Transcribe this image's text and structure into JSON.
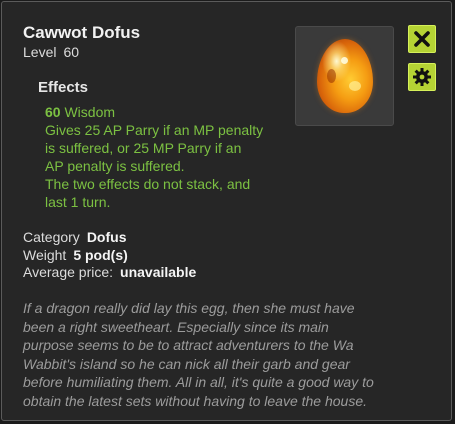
{
  "item": {
    "name": "Cawwot Dofus",
    "level_label": "Level",
    "level_value": "60"
  },
  "effects": {
    "title": "Effects",
    "wisdom_value": "60",
    "wisdom_label": "Wisdom",
    "lines": [
      "Gives 25 AP Parry if an MP penalty",
      "is suffered, or 25 MP Parry if an",
      "AP penalty is suffered.",
      "The two effects do not stack, and",
      "last 1 turn."
    ]
  },
  "info": {
    "category_label": "Category",
    "category_value": "Dofus",
    "weight_label": "Weight",
    "weight_value": "5 pod(s)",
    "price_label": "Average price:",
    "price_value": "unavailable"
  },
  "description": {
    "lines": [
      "If a dragon really did lay this egg, then she must have",
      "been a right sweetheart. Especially since its main",
      "purpose seems to be to attract adventurers to the Wa",
      "Wabbit's island so he can nick all their garb and gear",
      "before humiliating them. All in all, it's quite a good way to",
      "obtain the latest sets without having to leave the house."
    ]
  },
  "icons": {
    "item_image": "orange-egg-icon",
    "close": "close-icon",
    "settings": "gear-icon"
  },
  "colors": {
    "effect_text": "#7cc142",
    "button_bg": "#b5d334",
    "background": "#262626",
    "description_text": "#9c9c9c"
  }
}
